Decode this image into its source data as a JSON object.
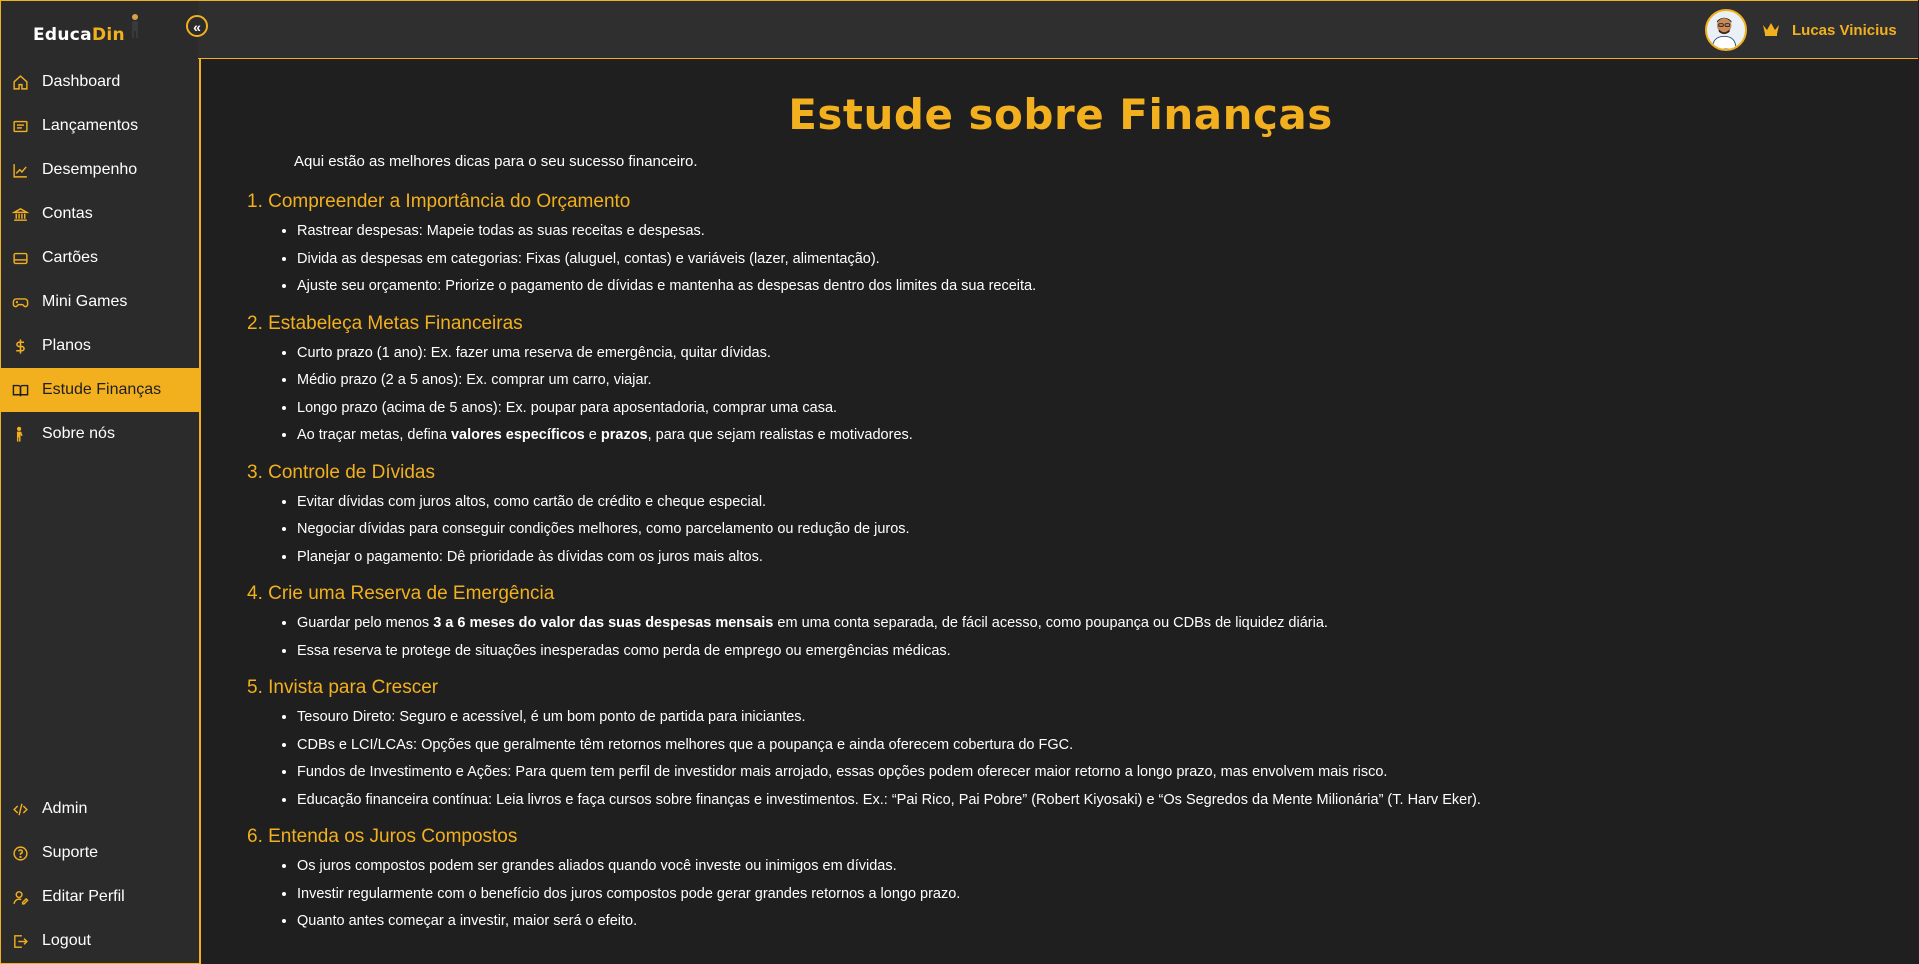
{
  "brand": {
    "part1": "Educa",
    "part2": "Din"
  },
  "colors": {
    "accent": "#f2b01e",
    "sidebar_bg": "#2b2b2b",
    "content_bg": "#1f1f1f",
    "topbar_bg": "#2f2f2f"
  },
  "sidebar": {
    "collapse_icon": "double-chevron-left-icon",
    "items": [
      {
        "label": "Dashboard",
        "icon": "home-icon",
        "active": false
      },
      {
        "label": "Lançamentos",
        "icon": "list-icon",
        "active": false
      },
      {
        "label": "Desempenho",
        "icon": "chart-line-icon",
        "active": false
      },
      {
        "label": "Contas",
        "icon": "bank-icon",
        "active": false
      },
      {
        "label": "Cartões",
        "icon": "card-icon",
        "active": false
      },
      {
        "label": "Mini Games",
        "icon": "gamepad-icon",
        "active": false
      },
      {
        "label": "Planos",
        "icon": "dollar-icon",
        "active": false
      },
      {
        "label": "Estude Finanças",
        "icon": "book-icon",
        "active": true
      },
      {
        "label": "Sobre nós",
        "icon": "person-icon",
        "active": false
      }
    ],
    "bottom_items": [
      {
        "label": "Admin",
        "icon": "code-icon"
      },
      {
        "label": "Suporte",
        "icon": "help-icon"
      },
      {
        "label": "Editar Perfil",
        "icon": "user-edit-icon"
      },
      {
        "label": "Logout",
        "icon": "logout-icon"
      }
    ]
  },
  "header": {
    "user_name": "Lucas Vinicius",
    "badge_icon": "crown-icon"
  },
  "main": {
    "title": "Estude sobre Finanças",
    "intro": "Aqui estão as melhores dicas para o seu sucesso financeiro.",
    "sections": [
      {
        "heading": "1. Compreender a Importância do Orçamento",
        "items": [
          [
            "Rastrear despesas: Mapeie todas as suas receitas e despesas."
          ],
          [
            "Divida as despesas em categorias: Fixas (aluguel, contas) e variáveis (lazer, alimentação)."
          ],
          [
            "Ajuste seu orçamento: Priorize o pagamento de dívidas e mantenha as despesas dentro dos limites da sua receita."
          ]
        ]
      },
      {
        "heading": "2. Estabeleça Metas Financeiras",
        "items": [
          [
            "Curto prazo (1 ano): Ex. fazer uma reserva de emergência, quitar dívidas."
          ],
          [
            "Médio prazo (2 a 5 anos): Ex. comprar um carro, viajar."
          ],
          [
            "Longo prazo (acima de 5 anos): Ex. poupar para aposentadoria, comprar uma casa."
          ],
          [
            "Ao traçar metas, defina ",
            "valores específicos",
            " e ",
            "prazos",
            ", para que sejam realistas e motivadores."
          ]
        ]
      },
      {
        "heading": "3. Controle de Dívidas",
        "items": [
          [
            "Evitar dívidas com juros altos, como cartão de crédito e cheque especial."
          ],
          [
            "Negociar dívidas para conseguir condições melhores, como parcelamento ou redução de juros."
          ],
          [
            "Planejar o pagamento: Dê prioridade às dívidas com os juros mais altos."
          ]
        ]
      },
      {
        "heading": "4. Crie uma Reserva de Emergência",
        "items": [
          [
            "Guardar pelo menos ",
            "3 a 6 meses do valor das suas despesas mensais",
            " em uma conta separada, de fácil acesso, como poupança ou CDBs de liquidez diária."
          ],
          [
            "Essa reserva te protege de situações inesperadas como perda de emprego ou emergências médicas."
          ]
        ]
      },
      {
        "heading": "5. Invista para Crescer",
        "items": [
          [
            "Tesouro Direto: Seguro e acessível, é um bom ponto de partida para iniciantes."
          ],
          [
            "CDBs e LCI/LCAs: Opções que geralmente têm retornos melhores que a poupança e ainda oferecem cobertura do FGC."
          ],
          [
            "Fundos de Investimento e Ações: Para quem tem perfil de investidor mais arrojado, essas opções podem oferecer maior retorno a longo prazo, mas envolvem mais risco."
          ],
          [
            "Educação financeira contínua: Leia livros e faça cursos sobre finanças e investimentos. Ex.: “Pai Rico, Pai Pobre” (Robert Kiyosaki) e “Os Segredos da Mente Milionária” (T. Harv Eker)."
          ]
        ]
      },
      {
        "heading": "6. Entenda os Juros Compostos",
        "items": [
          [
            "Os juros compostos podem ser grandes aliados quando você investe ou inimigos em dívidas."
          ],
          [
            "Investir regularmente com o benefício dos juros compostos pode gerar grandes retornos a longo prazo."
          ],
          [
            "Quanto antes começar a investir, maior será o efeito."
          ]
        ]
      }
    ]
  }
}
